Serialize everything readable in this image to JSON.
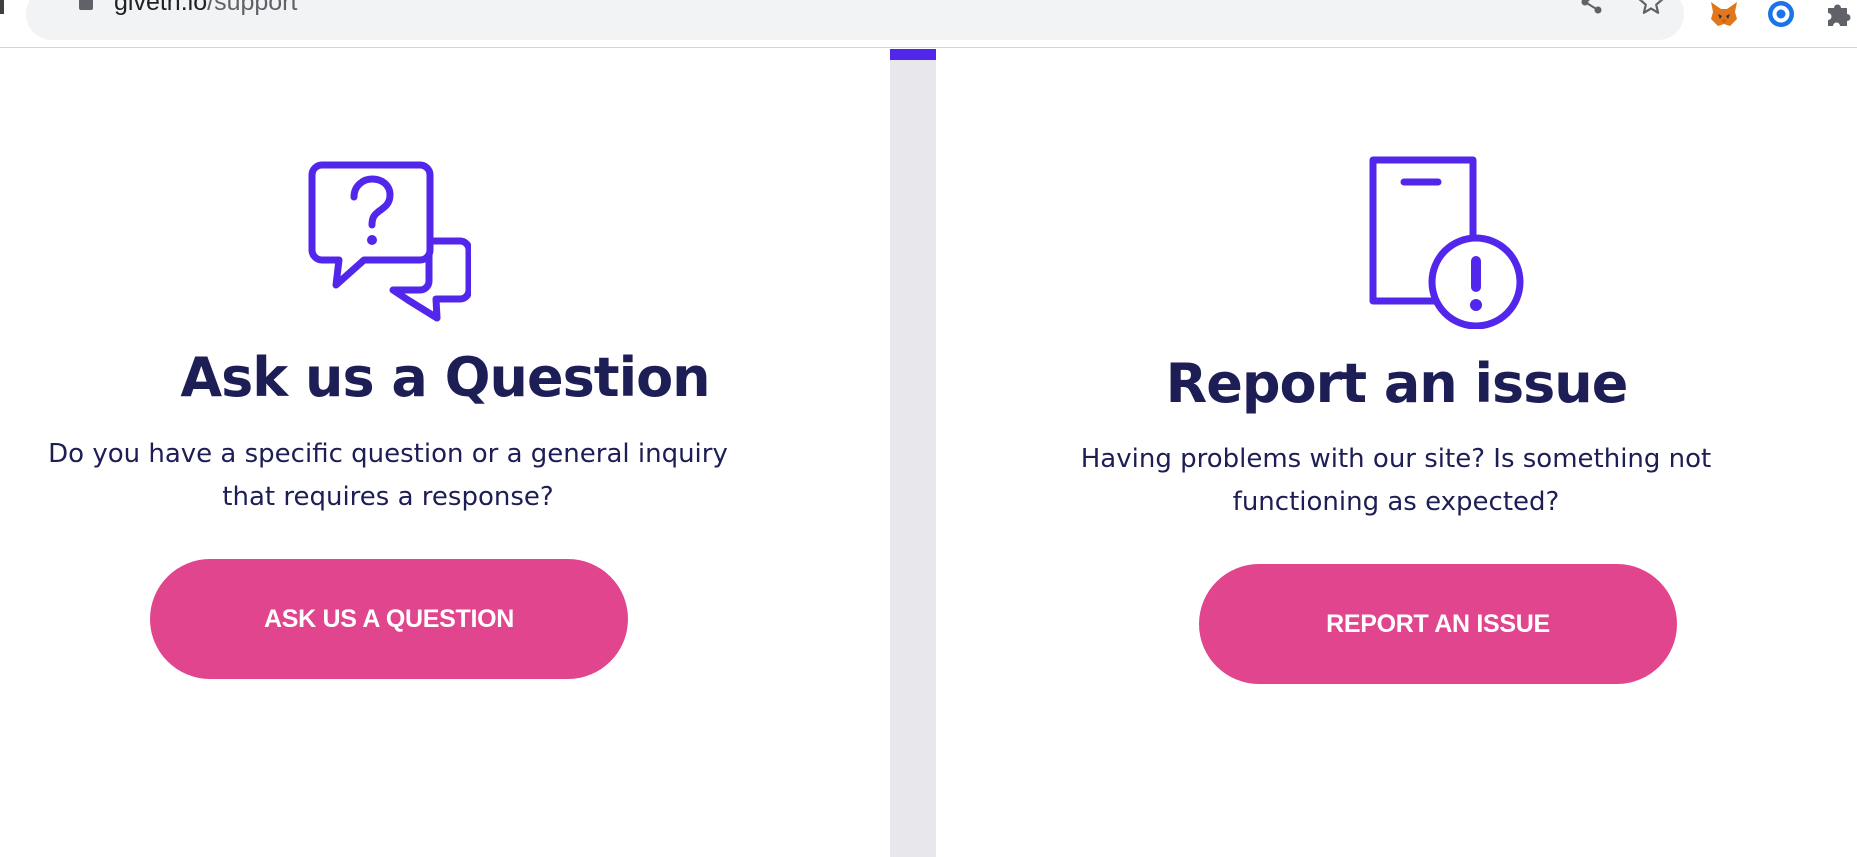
{
  "browser": {
    "url_host": "giveth.io",
    "url_path": "/support",
    "icons": [
      "lock-icon",
      "share-icon",
      "star-icon",
      "metamask-extension-icon",
      "extension-icon",
      "puzzle-extensions-icon"
    ]
  },
  "colors": {
    "accent_purple": "#5326ec",
    "title_navy": "#1d1e55",
    "button_pink": "#e1458d"
  },
  "cards": [
    {
      "icon": "question-chat-icon",
      "title": "Ask us a Question",
      "description_line1": "Do you have a specific question or a general inquiry",
      "description_line2": "that requires a response?",
      "button_label": "ASK US A QUESTION"
    },
    {
      "icon": "phone-alert-icon",
      "title": "Report an issue",
      "description_line1": "Having problems with our site? Is something not",
      "description_line2": "functioning as expected?",
      "button_label": "REPORT AN ISSUE"
    }
  ]
}
